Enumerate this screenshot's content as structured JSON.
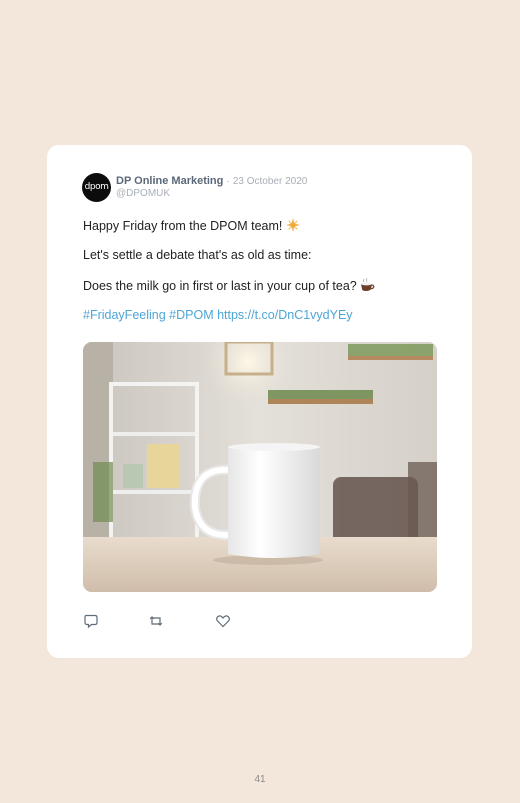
{
  "tweet": {
    "avatar_text": "dpom",
    "author": "DP Online Marketing",
    "separator": "·",
    "date": "23 October 2020",
    "handle": "@DPOMUK",
    "lines": [
      "Happy Friday from the DPOM team!",
      "Let's settle a debate that's as old as time:",
      "Does the milk go in first or last in your cup of tea?",
      "#FridayFeeling #DPOM https://t.co/DnC1vydYEy"
    ],
    "image_description": "White mug on a wooden table with a blurred cafe background"
  },
  "icons": {
    "sun": "sun-emoji-icon",
    "tea": "tea-cup-emoji-icon",
    "reply": "reply-icon",
    "retweet": "retweet-icon",
    "like": "heart-icon"
  },
  "colors": {
    "background": "#f3e7dc",
    "card": "#ffffff",
    "author": "#5b6878",
    "meta": "#a7aeb6",
    "link": "#4ea6d6"
  },
  "page": {
    "number": "41"
  }
}
